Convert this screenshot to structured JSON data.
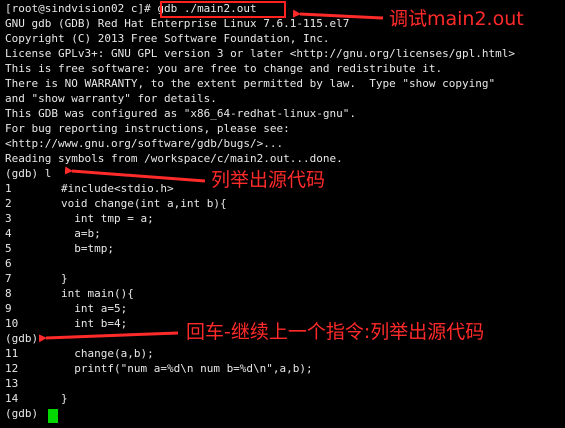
{
  "terminal": {
    "prompt": "[root@sindvision02 c]# ",
    "command": "gdb ./main2.out",
    "banner": [
      "GNU gdb (GDB) Red Hat Enterprise Linux 7.6.1-115.el7",
      "Copyright (C) 2013 Free Software Foundation, Inc.",
      "License GPLv3+: GNU GPL version 3 or later <http://gnu.org/licenses/gpl.html>",
      "This is free software: you are free to change and redistribute it.",
      "There is NO WARRANTY, to the extent permitted by law.  Type \"show copying\"",
      "and \"show warranty\" for details.",
      "This GDB was configured as \"x86_64-redhat-linux-gnu\".",
      "For bug reporting instructions, please see:",
      "<http://www.gnu.org/software/gdb/bugs/>...",
      "Reading symbols from /workspace/c/main2.out...done."
    ],
    "gdb_list_cmd": "(gdb) l",
    "listing1": [
      {
        "num": "1",
        "code": "#include<stdio.h>"
      },
      {
        "num": "2",
        "code": "void change(int a,int b){"
      },
      {
        "num": "3",
        "code": "  int tmp = a;"
      },
      {
        "num": "4",
        "code": "  a=b;"
      },
      {
        "num": "5",
        "code": "  b=tmp;"
      },
      {
        "num": "6",
        "code": ""
      },
      {
        "num": "7",
        "code": "}"
      },
      {
        "num": "8",
        "code": "int main(){"
      },
      {
        "num": "9",
        "code": "  int a=5;"
      },
      {
        "num": "10",
        "code": "  int b=4;"
      }
    ],
    "gdb_empty_cmd": "(gdb)",
    "listing2": [
      {
        "num": "11",
        "code": "  change(a,b);"
      },
      {
        "num": "12",
        "code": "  printf(\"num a=%d\\n num b=%d\\n\",a,b);"
      },
      {
        "num": "13",
        "code": ""
      },
      {
        "num": "14",
        "code": "}"
      }
    ],
    "final_prompt": "(gdb) "
  },
  "annotations": {
    "debug": "调试main2.out",
    "list": "列举出源代码",
    "repeat": "回车-继续上一个指令:列举出源代码",
    "color": "#ff2a2a"
  },
  "colors": {
    "background": "#000000",
    "text": "#e8e8e8",
    "cursor": "#00d800",
    "highlight_box": "#ff2020"
  }
}
